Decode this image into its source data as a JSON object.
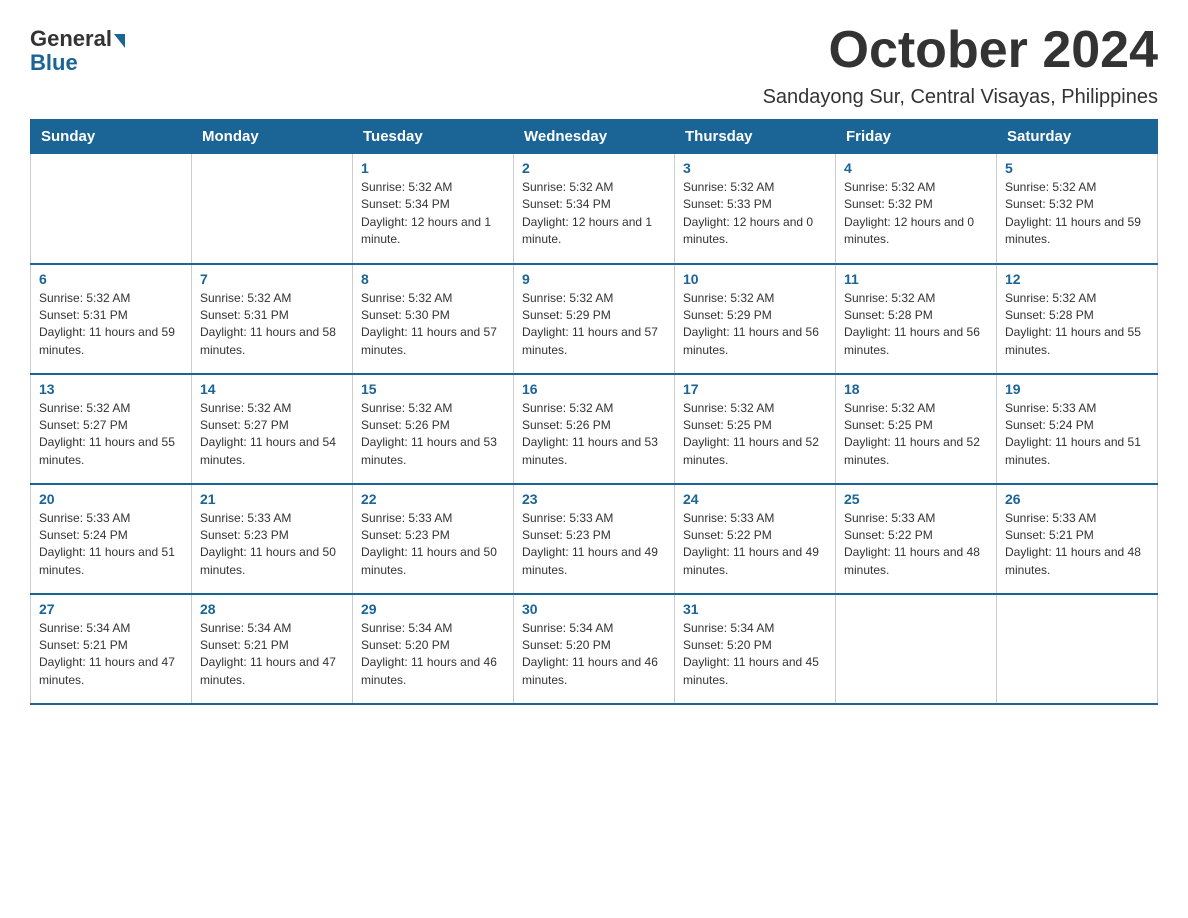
{
  "logo": {
    "general": "General",
    "blue": "Blue"
  },
  "header": {
    "month_year": "October 2024",
    "location": "Sandayong Sur, Central Visayas, Philippines"
  },
  "days_of_week": [
    "Sunday",
    "Monday",
    "Tuesday",
    "Wednesday",
    "Thursday",
    "Friday",
    "Saturday"
  ],
  "weeks": [
    [
      {
        "day": "",
        "info": ""
      },
      {
        "day": "",
        "info": ""
      },
      {
        "day": "1",
        "info": "Sunrise: 5:32 AM\nSunset: 5:34 PM\nDaylight: 12 hours and 1 minute."
      },
      {
        "day": "2",
        "info": "Sunrise: 5:32 AM\nSunset: 5:34 PM\nDaylight: 12 hours and 1 minute."
      },
      {
        "day": "3",
        "info": "Sunrise: 5:32 AM\nSunset: 5:33 PM\nDaylight: 12 hours and 0 minutes."
      },
      {
        "day": "4",
        "info": "Sunrise: 5:32 AM\nSunset: 5:32 PM\nDaylight: 12 hours and 0 minutes."
      },
      {
        "day": "5",
        "info": "Sunrise: 5:32 AM\nSunset: 5:32 PM\nDaylight: 11 hours and 59 minutes."
      }
    ],
    [
      {
        "day": "6",
        "info": "Sunrise: 5:32 AM\nSunset: 5:31 PM\nDaylight: 11 hours and 59 minutes."
      },
      {
        "day": "7",
        "info": "Sunrise: 5:32 AM\nSunset: 5:31 PM\nDaylight: 11 hours and 58 minutes."
      },
      {
        "day": "8",
        "info": "Sunrise: 5:32 AM\nSunset: 5:30 PM\nDaylight: 11 hours and 57 minutes."
      },
      {
        "day": "9",
        "info": "Sunrise: 5:32 AM\nSunset: 5:29 PM\nDaylight: 11 hours and 57 minutes."
      },
      {
        "day": "10",
        "info": "Sunrise: 5:32 AM\nSunset: 5:29 PM\nDaylight: 11 hours and 56 minutes."
      },
      {
        "day": "11",
        "info": "Sunrise: 5:32 AM\nSunset: 5:28 PM\nDaylight: 11 hours and 56 minutes."
      },
      {
        "day": "12",
        "info": "Sunrise: 5:32 AM\nSunset: 5:28 PM\nDaylight: 11 hours and 55 minutes."
      }
    ],
    [
      {
        "day": "13",
        "info": "Sunrise: 5:32 AM\nSunset: 5:27 PM\nDaylight: 11 hours and 55 minutes."
      },
      {
        "day": "14",
        "info": "Sunrise: 5:32 AM\nSunset: 5:27 PM\nDaylight: 11 hours and 54 minutes."
      },
      {
        "day": "15",
        "info": "Sunrise: 5:32 AM\nSunset: 5:26 PM\nDaylight: 11 hours and 53 minutes."
      },
      {
        "day": "16",
        "info": "Sunrise: 5:32 AM\nSunset: 5:26 PM\nDaylight: 11 hours and 53 minutes."
      },
      {
        "day": "17",
        "info": "Sunrise: 5:32 AM\nSunset: 5:25 PM\nDaylight: 11 hours and 52 minutes."
      },
      {
        "day": "18",
        "info": "Sunrise: 5:32 AM\nSunset: 5:25 PM\nDaylight: 11 hours and 52 minutes."
      },
      {
        "day": "19",
        "info": "Sunrise: 5:33 AM\nSunset: 5:24 PM\nDaylight: 11 hours and 51 minutes."
      }
    ],
    [
      {
        "day": "20",
        "info": "Sunrise: 5:33 AM\nSunset: 5:24 PM\nDaylight: 11 hours and 51 minutes."
      },
      {
        "day": "21",
        "info": "Sunrise: 5:33 AM\nSunset: 5:23 PM\nDaylight: 11 hours and 50 minutes."
      },
      {
        "day": "22",
        "info": "Sunrise: 5:33 AM\nSunset: 5:23 PM\nDaylight: 11 hours and 50 minutes."
      },
      {
        "day": "23",
        "info": "Sunrise: 5:33 AM\nSunset: 5:23 PM\nDaylight: 11 hours and 49 minutes."
      },
      {
        "day": "24",
        "info": "Sunrise: 5:33 AM\nSunset: 5:22 PM\nDaylight: 11 hours and 49 minutes."
      },
      {
        "day": "25",
        "info": "Sunrise: 5:33 AM\nSunset: 5:22 PM\nDaylight: 11 hours and 48 minutes."
      },
      {
        "day": "26",
        "info": "Sunrise: 5:33 AM\nSunset: 5:21 PM\nDaylight: 11 hours and 48 minutes."
      }
    ],
    [
      {
        "day": "27",
        "info": "Sunrise: 5:34 AM\nSunset: 5:21 PM\nDaylight: 11 hours and 47 minutes."
      },
      {
        "day": "28",
        "info": "Sunrise: 5:34 AM\nSunset: 5:21 PM\nDaylight: 11 hours and 47 minutes."
      },
      {
        "day": "29",
        "info": "Sunrise: 5:34 AM\nSunset: 5:20 PM\nDaylight: 11 hours and 46 minutes."
      },
      {
        "day": "30",
        "info": "Sunrise: 5:34 AM\nSunset: 5:20 PM\nDaylight: 11 hours and 46 minutes."
      },
      {
        "day": "31",
        "info": "Sunrise: 5:34 AM\nSunset: 5:20 PM\nDaylight: 11 hours and 45 minutes."
      },
      {
        "day": "",
        "info": ""
      },
      {
        "day": "",
        "info": ""
      }
    ]
  ]
}
